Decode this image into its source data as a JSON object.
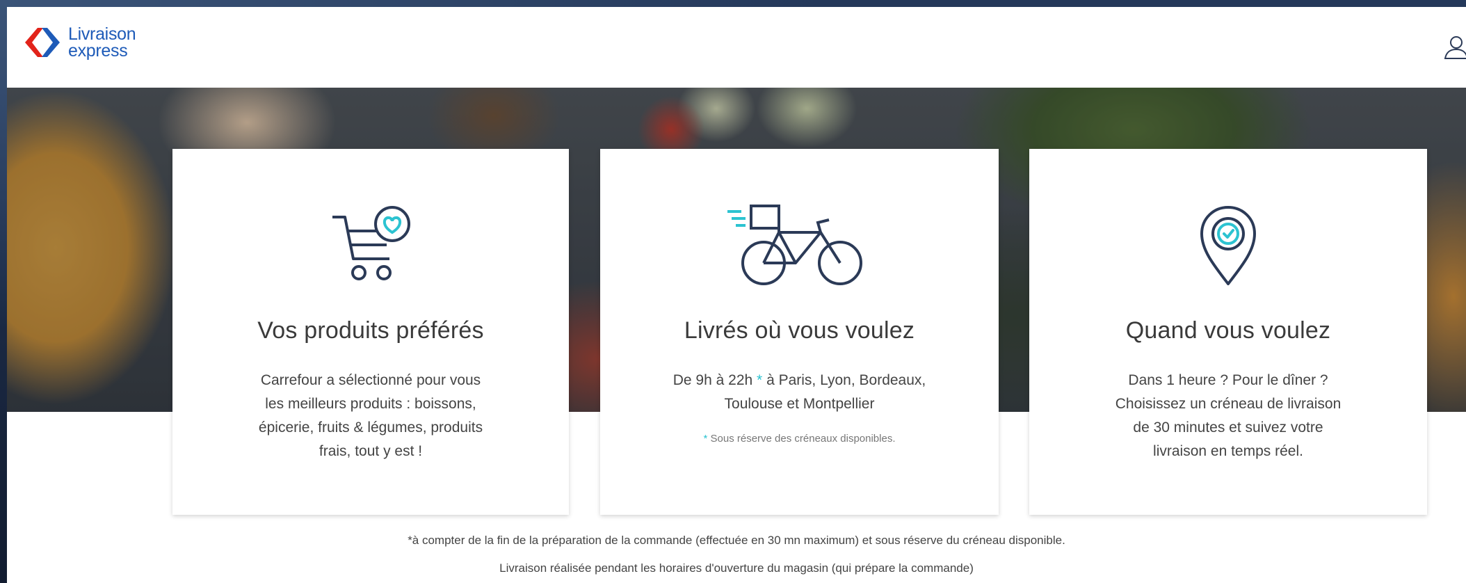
{
  "brand": {
    "line1": "Livraison",
    "line2": "express",
    "colors": {
      "blue": "#1e5bb8",
      "red": "#e2231a",
      "teal": "#2cc3d1",
      "navy": "#2b3a57"
    }
  },
  "header": {
    "user_icon": "user-icon"
  },
  "cards": [
    {
      "icon": "shopping-cart-heart-icon",
      "title": "Vos produits préférés",
      "lines": [
        "Carrefour a sélectionné pour vous",
        "les meilleurs produits : boissons,",
        "épicerie, fruits & légumes, produits",
        "frais, tout y est !"
      ]
    },
    {
      "icon": "delivery-bike-icon",
      "title": "Livrés où vous voulez",
      "line1_before": "De 9h à 22h",
      "line1_star": "*",
      "line1_after": "à Paris, Lyon, Bordeaux,",
      "line2": "Toulouse et Montpellier",
      "note_star": "*",
      "note": "Sous réserve des créneaux disponibles."
    },
    {
      "icon": "location-clock-pin-icon",
      "title": "Quand vous voulez",
      "lines": [
        "Dans 1 heure ? Pour le dîner ?",
        "Choisissez un créneau de livraison",
        "de 30 minutes et suivez votre",
        "livraison en temps réel."
      ]
    }
  ],
  "footer": {
    "line1": "*à compter de la fin de la préparation de la commande (effectuée en 30 mn maximum) et sous réserve du créneau disponible.",
    "line2": "Livraison réalisée pendant les horaires d'ouverture du magasin (qui prépare la commande)"
  }
}
